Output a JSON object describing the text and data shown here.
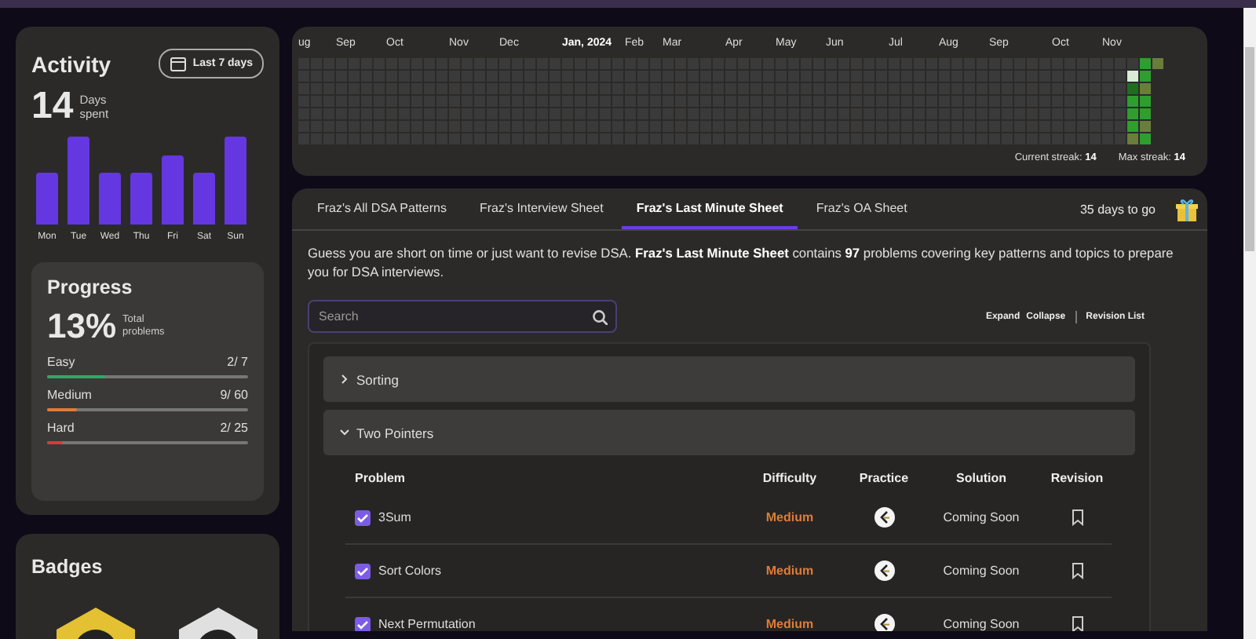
{
  "activity": {
    "title": "Activity",
    "range_button": "Last 7 days",
    "days_count": "14",
    "days_caption": "Days spent",
    "days": [
      "Mon",
      "Tue",
      "Wed",
      "Thu",
      "Fri",
      "Sat",
      "Sun"
    ]
  },
  "progress": {
    "title": "Progress",
    "percent": "13%",
    "caption": "Total problems",
    "levels": [
      {
        "name": "Easy",
        "count": "2/ 7",
        "level": 0.29,
        "color": "#2fa866"
      },
      {
        "name": "Medium",
        "count": "9/ 60",
        "level": 0.15,
        "color": "#e07b39"
      },
      {
        "name": "Hard",
        "count": "2/ 25",
        "level": 0.08,
        "color": "#d63b3b"
      }
    ]
  },
  "badges": {
    "title": "Badges"
  },
  "heatmap": {
    "months": [
      {
        "label": "ug",
        "current": false
      },
      {
        "label": "Sep",
        "current": false
      },
      {
        "label": "Oct",
        "current": false
      },
      {
        "label": "Nov",
        "current": false
      },
      {
        "label": "Dec",
        "current": false
      },
      {
        "label": "Jan, 2024",
        "current": true
      },
      {
        "label": "Feb",
        "current": false
      },
      {
        "label": "Mar",
        "current": false
      },
      {
        "label": "Apr",
        "current": false
      },
      {
        "label": "May",
        "current": false
      },
      {
        "label": "Jun",
        "current": false
      },
      {
        "label": "Jul",
        "current": false
      },
      {
        "label": "Aug",
        "current": false
      },
      {
        "label": "Sep",
        "current": false
      },
      {
        "label": "Oct",
        "current": false
      },
      {
        "label": "Nov",
        "current": false
      }
    ],
    "recent_weeks": [
      {
        "days": [
          {
            "color": "#3a3a3a"
          },
          {
            "color": "#d8ecd8"
          },
          {
            "color": "#1f6e1f"
          },
          {
            "color": "#2e9e2e"
          },
          {
            "color": "#2e9e2e"
          },
          {
            "color": "#2e9e2e"
          },
          {
            "color": "#6b7d3a"
          }
        ]
      },
      {
        "days": [
          {
            "color": "#2e9e2e"
          },
          {
            "color": "#2e9e2e"
          },
          {
            "color": "#6b7d3a"
          },
          {
            "color": "#2e9e2e"
          },
          {
            "color": "#2e9e2e"
          },
          {
            "color": "#6b7d3a"
          },
          {
            "color": "#2e9e2e"
          }
        ]
      },
      {
        "days": [
          {
            "color": "#6b7d3a"
          }
        ]
      }
    ],
    "current_streak": "Current streak: **14**",
    "max_streak": "Max streak: **14**"
  },
  "sheet": {
    "tabs": [
      {
        "label": "Fraz's All DSA Patterns",
        "selected": false
      },
      {
        "label": "Fraz's Interview Sheet",
        "selected": false
      },
      {
        "label": "Fraz's Last Minute Sheet",
        "selected": true
      },
      {
        "label": "Fraz's OA Sheet",
        "selected": false
      }
    ],
    "countdown": "35 days to go",
    "description": "Guess you are short on time or just want to revise DSA. **Fraz's Last Minute Sheet** contains **97** problems covering key patterns and topics to prepare you for DSA interviews.",
    "search": {
      "placeholder": "Search"
    },
    "actions": [
      "Expand",
      "Collapse",
      "Revision List"
    ],
    "sections": [
      {
        "title": "Sorting",
        "expanded": false
      },
      {
        "title": "Two Pointers",
        "expanded": true,
        "columns": [
          "Problem",
          "Difficulty",
          "Practice",
          "Solution",
          "Revision"
        ],
        "problems": [
          {
            "name": "3Sum",
            "done": true,
            "difficulty": "Medium",
            "color": "#e07b39",
            "solution": "Coming Soon",
            "bookmarked": false
          },
          {
            "name": "Sort Colors",
            "done": true,
            "difficulty": "Medium",
            "color": "#e07b39",
            "solution": "Coming Soon",
            "bookmarked": false
          },
          {
            "name": "Next Permutation",
            "done": true,
            "difficulty": "Medium",
            "color": "#e07b39",
            "solution": "Coming Soon",
            "bookmarked": false
          }
        ]
      }
    ]
  }
}
